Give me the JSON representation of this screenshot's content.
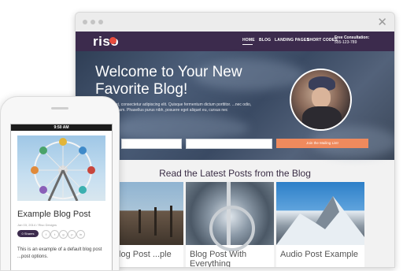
{
  "browser": {
    "close_glyph": "✕",
    "nav": {
      "logo": "riso",
      "links": [
        "HOME",
        "BLOG",
        "LANDING PAGES",
        "SHORT CODES"
      ],
      "consultation_label": "Free Consultation:",
      "consultation_phone": "555-123-789"
    },
    "hero": {
      "title": "Welcome to Your New Favorite Blog!",
      "body": "dolor sit amet, consectetur adipiscing elit. Quisque fermentum dictum porttitor. ...nec odio, in hendrerit diam. Phasellus purus nibh, posuere eget aliquet eu, cursus nec",
      "cta_label": "Join the Mailing List!"
    },
    "posts_section_title": "Read the Latest Posts from the Blog",
    "posts": [
      {
        "title": "...lt Blog Post ...ple"
      },
      {
        "title": "Blog Post With Everything"
      },
      {
        "title": "Audio Post Example"
      }
    ]
  },
  "phone": {
    "status_time": "9:50 AM",
    "post_title": "Example Blog Post",
    "post_meta": "Jan 03, 2014 / Riso Designs",
    "share_label": "0 Shares",
    "social_icons": [
      "f",
      "t",
      "g",
      "p",
      "in"
    ],
    "excerpt": "This is an example of a default blog post ...post options."
  },
  "colors": {
    "brand_purple": "#3c2b4d",
    "accent_orange": "#ef8a5d",
    "logo_red": "#e84c3d"
  }
}
